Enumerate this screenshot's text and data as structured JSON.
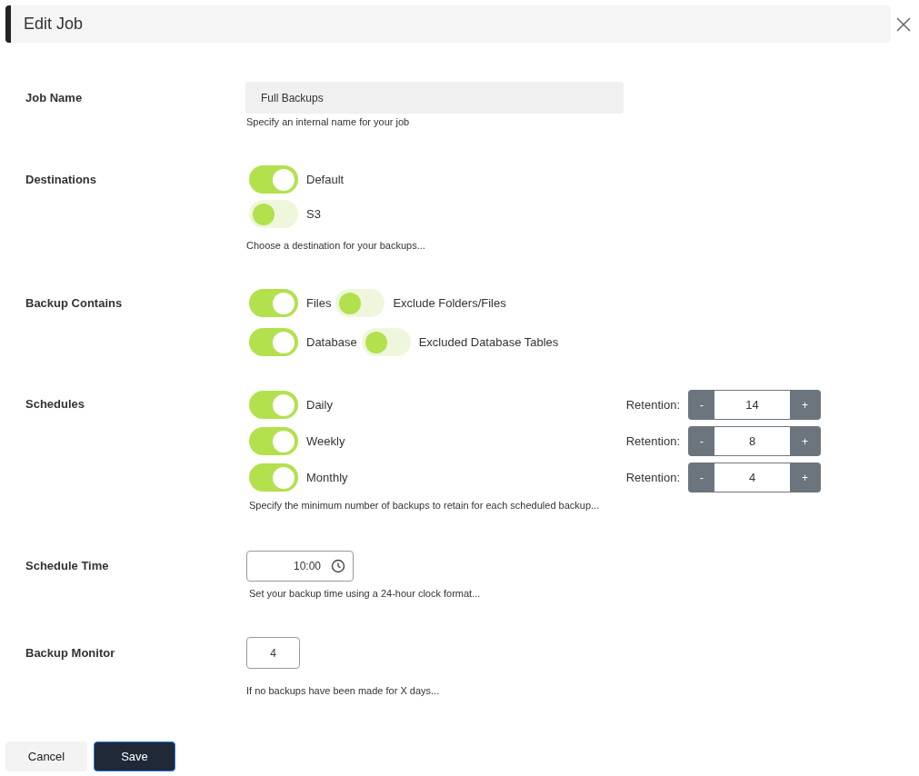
{
  "dialog": {
    "title": "Edit Job"
  },
  "job_name": {
    "label": "Job Name",
    "value": "Full Backups",
    "hint": "Specify an internal name for your job"
  },
  "destinations": {
    "label": "Destinations",
    "items": [
      {
        "label": "Default",
        "on": true
      },
      {
        "label": "S3",
        "on": false
      }
    ],
    "hint": "Choose a destination for your backups..."
  },
  "backup_contains": {
    "label": "Backup Contains",
    "rows": [
      {
        "label": "Files",
        "on": true,
        "sub_label": "Exclude Folders/Files",
        "sub_on": false
      },
      {
        "label": "Database",
        "on": true,
        "sub_label": "Excluded Database Tables",
        "sub_on": false
      }
    ]
  },
  "schedules": {
    "label": "Schedules",
    "rows": [
      {
        "label": "Daily",
        "on": true,
        "retention_label": "Retention:",
        "minus": "-",
        "value": "14",
        "plus": "+"
      },
      {
        "label": "Weekly",
        "on": true,
        "retention_label": "Retention:",
        "minus": "-",
        "value": "8",
        "plus": "+"
      },
      {
        "label": "Monthly",
        "on": true,
        "retention_label": "Retention:",
        "minus": "-",
        "value": "4",
        "plus": "+"
      }
    ],
    "hint": "Specify the minimum number of backups to retain for each scheduled backup..."
  },
  "schedule_time": {
    "label": "Schedule Time",
    "value": "10:00",
    "hint": "Set your backup time using a 24-hour clock format..."
  },
  "backup_monitor": {
    "label": "Backup Monitor",
    "value": "4",
    "hint": "If no backups have been made for X days..."
  },
  "buttons": [
    {
      "label": "Cancel",
      "kind": "secondary"
    },
    {
      "label": "Save",
      "kind": "primary"
    }
  ]
}
